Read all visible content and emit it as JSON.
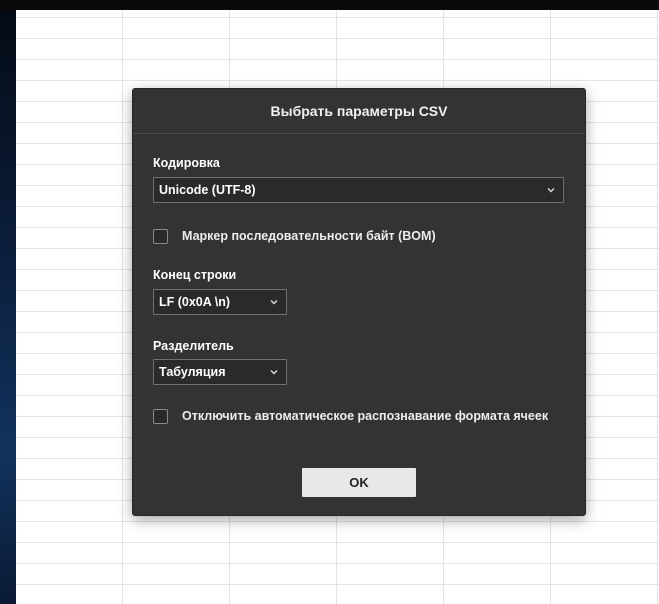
{
  "dialog": {
    "title": "Выбрать параметры CSV",
    "encoding": {
      "label": "Кодировка",
      "value": "Unicode (UTF-8)"
    },
    "bom_checkbox": {
      "label": "Маркер последовательности байт (BOM)",
      "checked": false
    },
    "line_ending": {
      "label": "Конец строки",
      "value": "LF (0x0A \\n)"
    },
    "delimiter": {
      "label": "Разделитель",
      "value": "Табуляция"
    },
    "auto_format_checkbox": {
      "label": "Отключить автоматическое распознавание формата ячеек",
      "checked": false
    },
    "ok_label": "OK"
  },
  "colors": {
    "dialog_bg": "#333333",
    "select_bg": "#2a2a2a",
    "button_bg": "#e8e8e8"
  },
  "icons": {
    "select_chevron": "chevron-down-icon"
  }
}
